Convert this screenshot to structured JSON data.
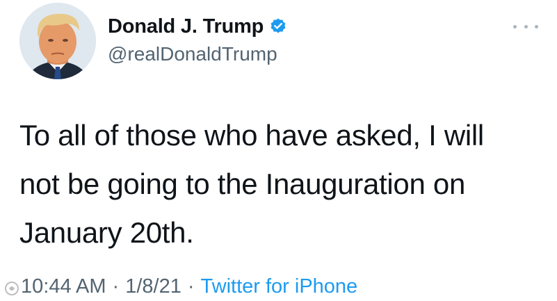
{
  "user": {
    "display_name": "Donald J. Trump",
    "handle": "@realDonaldTrump",
    "verified_icon": "verified-badge-icon",
    "avatar_icon": "avatar"
  },
  "header": {
    "more_icon": "more-options-icon"
  },
  "tweet": {
    "lines": [
      "To all of those who have asked, I will",
      "not be going to the Inauguration on",
      "January 20th."
    ]
  },
  "meta": {
    "time": "10:44 AM",
    "separator": "·",
    "date": "1/8/21",
    "source": "Twitter for iPhone"
  },
  "colors": {
    "text": "#0f1419",
    "secondary": "#536471",
    "accent": "#1d9bf0"
  }
}
